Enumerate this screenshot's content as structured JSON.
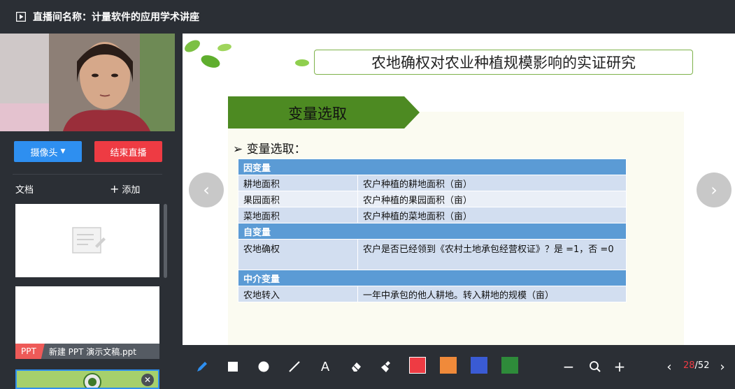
{
  "window": {
    "title": "直播间名称：计量软件的应用学术讲座"
  },
  "sidebar": {
    "camera_button": "摄像头",
    "end_button": "结束直播",
    "docs_label": "文档",
    "add_label": "添加",
    "ppt_tag": "PPT",
    "ppt_filename": "新建 PPT 演示文稿.ppt"
  },
  "slide": {
    "title": "农地确权对农业种植规模影响的实证研究",
    "section": "变量选取",
    "bullet": "变量选取：",
    "table": {
      "dependent_header": "因变量",
      "rows_dependent": [
        {
          "name": "耕地面积",
          "desc": "农户种植的耕地面积（亩）"
        },
        {
          "name": "果园面积",
          "desc": "农户种植的果园面积（亩）"
        },
        {
          "name": "菜地面积",
          "desc": "农户种植的菜地面积（亩）"
        }
      ],
      "independent_header": "自变量",
      "rows_independent": [
        {
          "name": "农地确权",
          "desc": "农户是否已经领到《农村土地承包经营权证》？是 =1，否 =0"
        }
      ],
      "mediator_header": "中介变量",
      "rows_mediator": [
        {
          "name": "农地转入",
          "desc": "一年中承包的他人耕地。转入耕地的规模（亩）"
        }
      ]
    }
  },
  "toolbar": {
    "colors": [
      "#ee3b43",
      "#f08a3a",
      "#3a5bd4",
      "#2e8b3a"
    ],
    "page_current": "28",
    "page_total": "/52"
  }
}
